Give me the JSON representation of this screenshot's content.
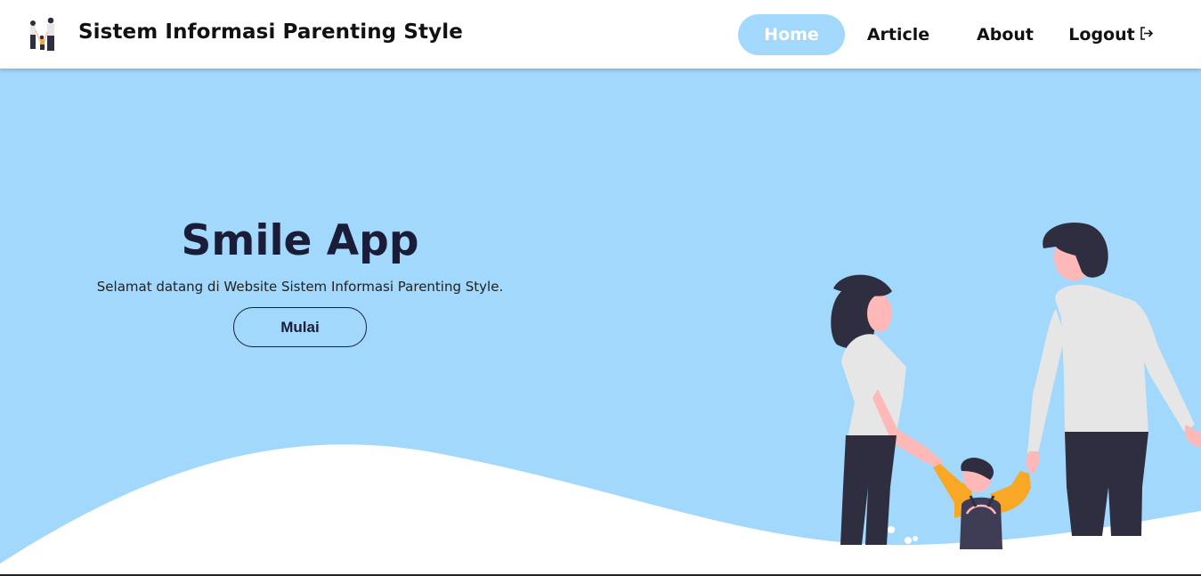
{
  "brand": {
    "title": "Sistem Informasi Parenting Style",
    "logo_icon": "family-logo-icon"
  },
  "nav": {
    "home": "Home",
    "article": "Article",
    "about": "About",
    "logout": "Logout",
    "logout_icon": "logout-arrow-icon",
    "active": "Home"
  },
  "hero": {
    "title": "Smile App",
    "subtitle": "Selamat datang di Website Sistem Informasi Parenting Style.",
    "button_label": "Mulai",
    "illustration": "family-walking-illustration"
  },
  "colors": {
    "accent": "#a1d8fc",
    "text_dark": "#1b1d38",
    "wave": "#ffffff",
    "shirt": "#e6e6e6",
    "pants": "#2f2e41",
    "skin": "#ffb8b8",
    "child_shirt": "#f9a826"
  }
}
